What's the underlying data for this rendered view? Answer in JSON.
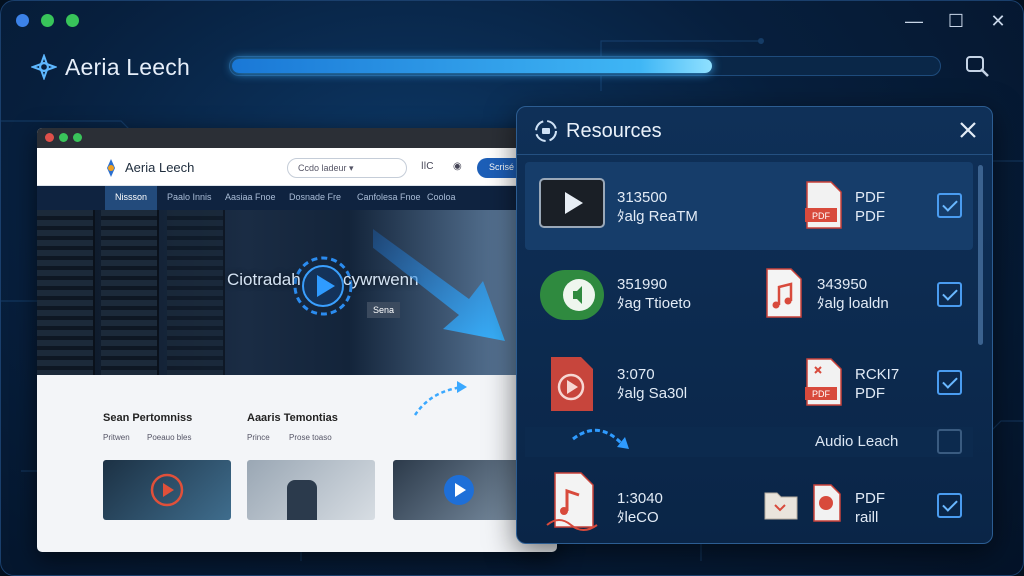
{
  "app": {
    "name": "Aeria Leech"
  },
  "window_controls": {
    "minimize": "—",
    "maximize": "☐",
    "close": "✕"
  },
  "download": {
    "progress": 0.68
  },
  "browser": {
    "logo": "Aeria Leech",
    "search_text": "Ccdo ladeur ▾",
    "ctrl": "ǀǀC",
    "button": "Scrisé ▾",
    "nav": [
      "Nissson",
      "Paalo Innis",
      "Aasiaa Fnoe",
      "Dosnade Fre",
      "Canfolesa Fnoe",
      "Cooloa"
    ],
    "hero_title_left": "Ciotradah",
    "hero_title_right": "cywrwenn",
    "hero_sub": "Sena",
    "section1": {
      "title": "Sean Pertomniss",
      "meta1": "Pritwen",
      "meta2": "Poeauo bles"
    },
    "section2": {
      "title": "Aaaris Temontias",
      "meta1": "Prince",
      "meta2": "Prose toaso"
    }
  },
  "resources": {
    "title": "Resources",
    "rows": [
      {
        "left_line1": "313500",
        "left_line2": "ﾀalg ReaTM",
        "right_line1": "PDF",
        "right_line2": "PDF",
        "checked": true,
        "selected": true
      },
      {
        "left_line1": "351990",
        "left_line2": "ﾀag Ttioeto",
        "right_line1": "343950",
        "right_line2": "ﾀalg loaldn",
        "checked": true,
        "selected": false
      },
      {
        "left_line1": "3:070",
        "left_line2": "ﾀalg Sa30l",
        "right_line1": "RCKI7",
        "right_line2": "PDF",
        "checked": true,
        "selected": false
      },
      {
        "left_line1": "1:3040",
        "left_line2": "ﾀleCO",
        "right_line1": "PDF",
        "right_line2": "raill",
        "checked": true,
        "selected": false
      }
    ],
    "audio_label": "Audio Leach",
    "audio_checked": false,
    "badge_pdf": "PDF"
  },
  "colors": {
    "accent": "#3fb6f5",
    "pdf_red": "#d84a3c",
    "panel": "#0f3058"
  }
}
